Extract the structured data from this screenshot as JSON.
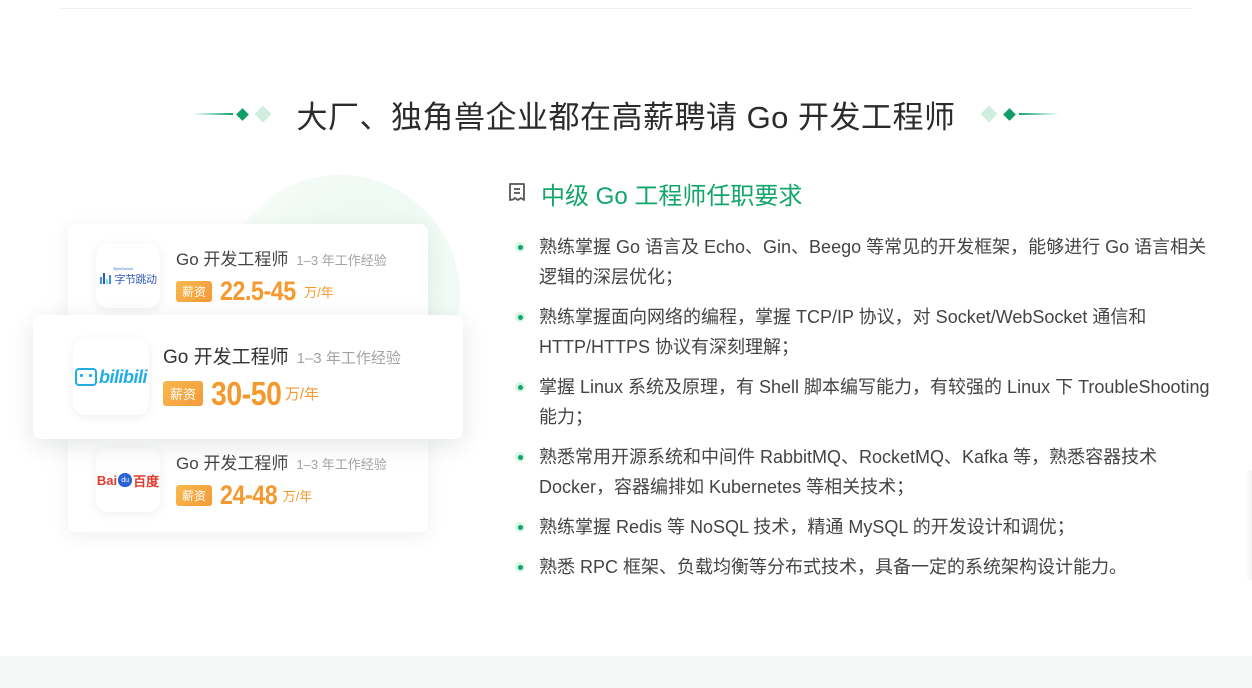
{
  "section_title": "大厂、独角兽企业都在高薪聘请 Go 开发工程师",
  "jobs": [
    {
      "company_logo": "字节跳动",
      "company_logo_small": "ByteDance",
      "title": "Go 开发工程师",
      "experience": "1–3 年工作经验",
      "salary_tag": "薪资",
      "salary": "22.5-45",
      "unit": "万/年"
    },
    {
      "company_logo": "bilibili",
      "title": "Go 开发工程师",
      "experience": "1–3 年工作经验",
      "salary_tag": "薪资",
      "salary": "30-50",
      "unit": "万/年"
    },
    {
      "company_logo_bai": "Bai",
      "company_logo_paw": "du",
      "company_logo_cn": "百度",
      "title": "Go 开发工程师",
      "experience": "1–3 年工作经验",
      "salary_tag": "薪资",
      "salary": "24-48",
      "unit": "万/年"
    }
  ],
  "requirements": {
    "icon": "document-icon",
    "title": "中级 Go 工程师任职要求",
    "items": [
      "熟练掌握 Go 语言及 Echo、Gin、Beego 等常见的开发框架，能够进行 Go 语言相关逻辑的深层优化；",
      "熟练掌握面向网络的编程，掌握 TCP/IP 协议，对 Socket/WebSocket 通信和 HTTP/HTTPS 协议有深刻理解；",
      "掌握 Linux 系统及原理，有 Shell 脚本编写能力，有较强的 Linux 下 TroubleShooting 能力；",
      "熟悉常用开源系统和中间件 RabbitMQ、RocketMQ、Kafka 等，熟悉容器技术 Docker，容器编排如 Kubernetes 等相关技术；",
      "熟练掌握 Redis 等 NoSQL 技术，精通 MySQL 的开发设计和调优；",
      "熟悉 RPC 框架、负载均衡等分布式技术，具备一定的系统架构设计能力。"
    ]
  },
  "colors": {
    "accent": "#12a56c",
    "salary": "#f3992e"
  }
}
